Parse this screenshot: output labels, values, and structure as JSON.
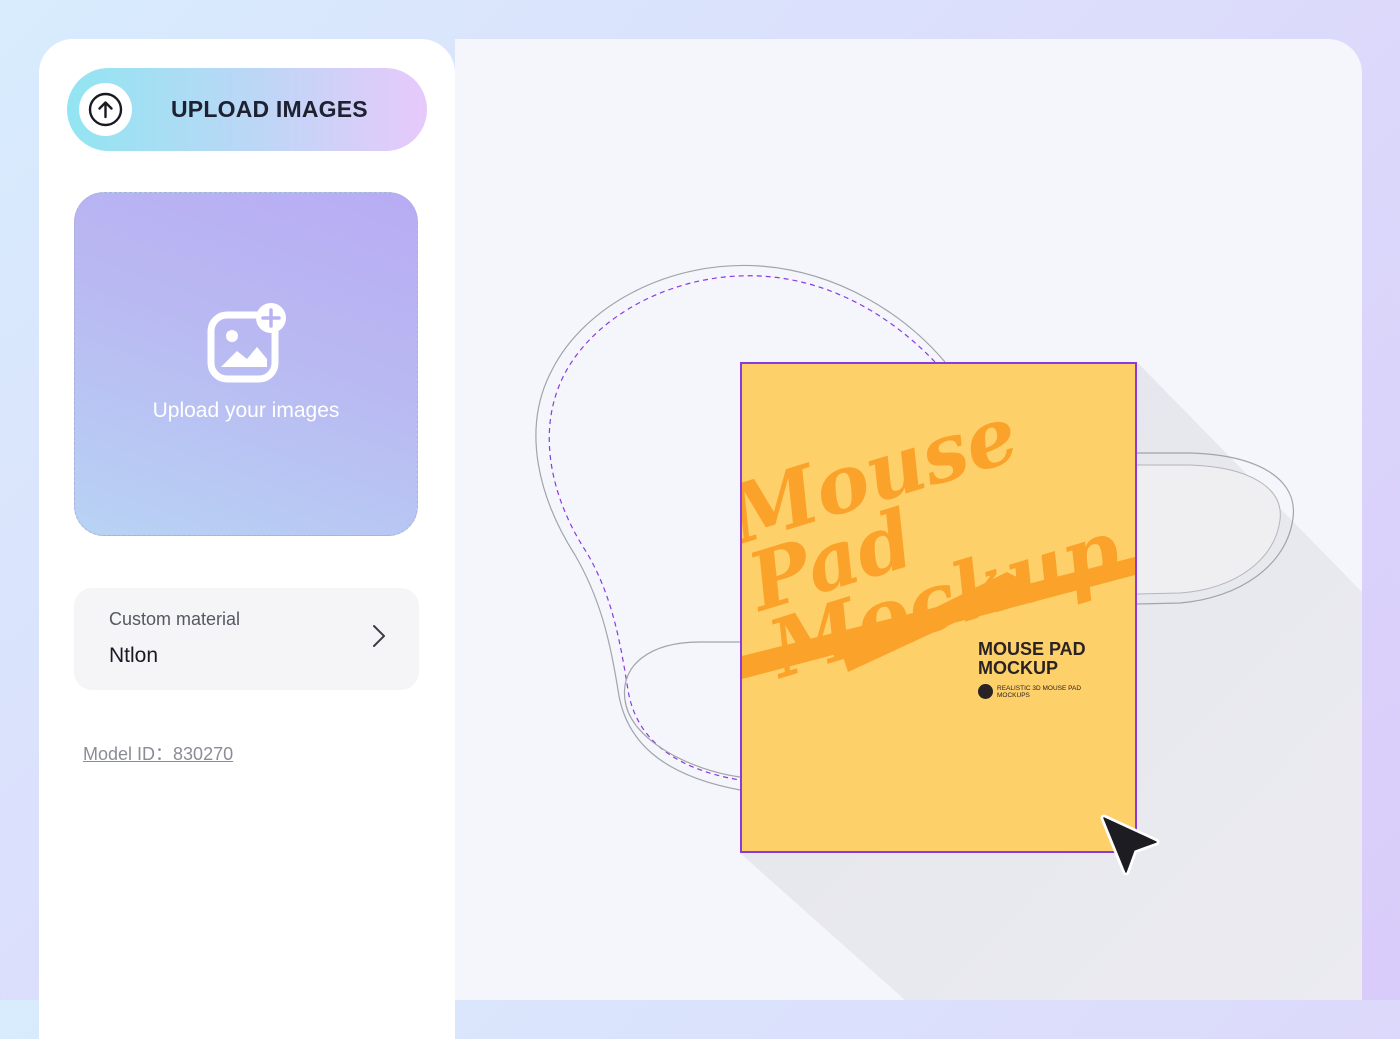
{
  "sidebar": {
    "upload_button_label": "UPLOAD IMAGES",
    "dropzone_text": "Upload your images",
    "material": {
      "title": "Custom material",
      "value": "Ntlon"
    },
    "model_id_label": "Model ID：",
    "model_id_value": "830270"
  },
  "preview": {
    "art_title_lines": [
      "Mouse",
      "Pad",
      "Mockup"
    ],
    "art_subtitle": "MOUSE PAD MOCKUP",
    "art_tagline": "REALISTIC 3D MOUSE PAD MOCKUPS"
  },
  "colors": {
    "accent_purple": "#8a3be0",
    "art_yellow": "#fed069",
    "art_orange": "#fba22a"
  },
  "icons": {
    "upload": "arrow-up-circle-icon",
    "add_image": "image-plus-icon",
    "chevron": "chevron-right-icon",
    "cursor": "pointer-cursor-icon"
  }
}
